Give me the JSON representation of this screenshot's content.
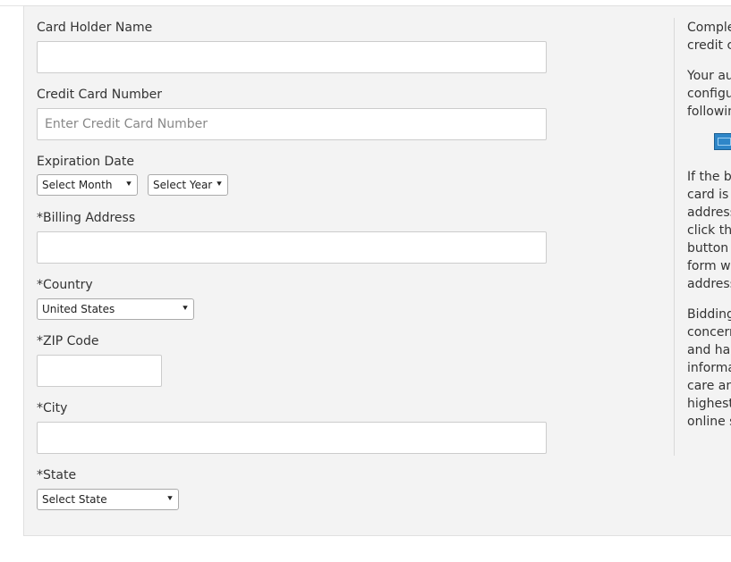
{
  "form": {
    "card_holder_label": "Card Holder Name",
    "card_holder_value": "",
    "card_number_label": "Credit Card Number",
    "card_number_placeholder": "Enter Credit Card Number",
    "expiration_label": "Expiration Date",
    "month_select": "Select Month",
    "year_select": "Select Year",
    "billing_address_label": "*Billing Address",
    "country_label": "*Country",
    "country_select": "United States",
    "zip_label": "*ZIP Code",
    "city_label": "*City",
    "state_label": "*State",
    "state_select": "Select State"
  },
  "sidebar": {
    "para1": [
      "Comple",
      "credit c"
    ],
    "para2": [
      "Your au",
      "configu",
      "followin"
    ],
    "para3": [
      "If the bi",
      "card is t",
      "address",
      "click the",
      "button a",
      "form wi",
      "address"
    ],
    "para4": [
      "Bidding",
      "concern",
      "and han",
      "informa",
      "care and",
      "highest",
      "online s"
    ]
  },
  "colors": {
    "panel_bg": "#f3f3f3",
    "card_logo": "#2e86c8"
  },
  "icons": {
    "card_logo": "credit-card-logo-icon",
    "dropdown": "chevron-down-icon"
  }
}
